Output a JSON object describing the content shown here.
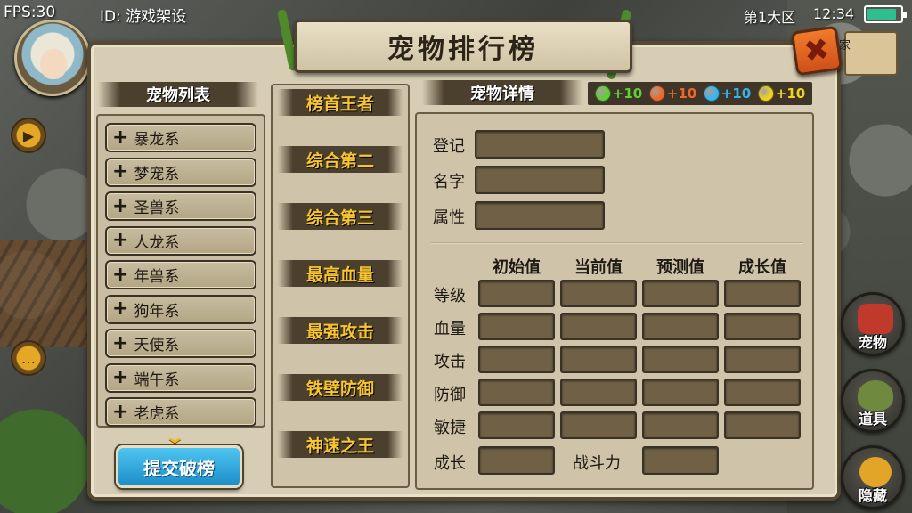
{
  "hud": {
    "fps": "FPS:30",
    "player_id": "ID: 游戏架设",
    "server": "第1大区",
    "clock": "12:34",
    "battery_level": 0.9
  },
  "panel": {
    "title": "宠物排行榜",
    "close_icon": "close-x-icon"
  },
  "left": {
    "header": "宠物列表",
    "items": [
      {
        "label": "暴龙系"
      },
      {
        "label": "梦宠系"
      },
      {
        "label": "圣兽系"
      },
      {
        "label": "人龙系"
      },
      {
        "label": "年兽系"
      },
      {
        "label": "狗年系"
      },
      {
        "label": "天使系"
      },
      {
        "label": "端午系"
      },
      {
        "label": "老虎系"
      }
    ],
    "submit_label": "提交破榜"
  },
  "ranking": {
    "items": [
      {
        "label": "榜首王者"
      },
      {
        "label": "综合第二"
      },
      {
        "label": "综合第三"
      },
      {
        "label": "最高血量"
      },
      {
        "label": "最强攻击"
      },
      {
        "label": "铁壁防御"
      },
      {
        "label": "神速之王"
      }
    ]
  },
  "detail": {
    "header": "宠物详情",
    "bonuses": [
      {
        "text": "+10",
        "color": "#5ed134",
        "gem": "green-gem-icon"
      },
      {
        "text": "+10",
        "color": "#f0662a",
        "gem": "orange-gem-icon"
      },
      {
        "text": "+10",
        "color": "#36b6f0",
        "gem": "blue-gem-icon"
      },
      {
        "text": "+10",
        "color": "#f2d31e",
        "gem": "yellow-gem-icon"
      }
    ],
    "info_labels": {
      "register": "登记",
      "name": "名字",
      "attribute": "属性"
    },
    "stat_columns": [
      "初始值",
      "当前值",
      "预测值",
      "成长值"
    ],
    "stat_rows": [
      "等级",
      "血量",
      "攻击",
      "防御",
      "敏捷"
    ],
    "growth_label": "成长",
    "power_label": "战斗力"
  },
  "side_menu": {
    "pet": "宠物",
    "items": "道具",
    "hide": "隐藏",
    "map_text": "家"
  }
}
